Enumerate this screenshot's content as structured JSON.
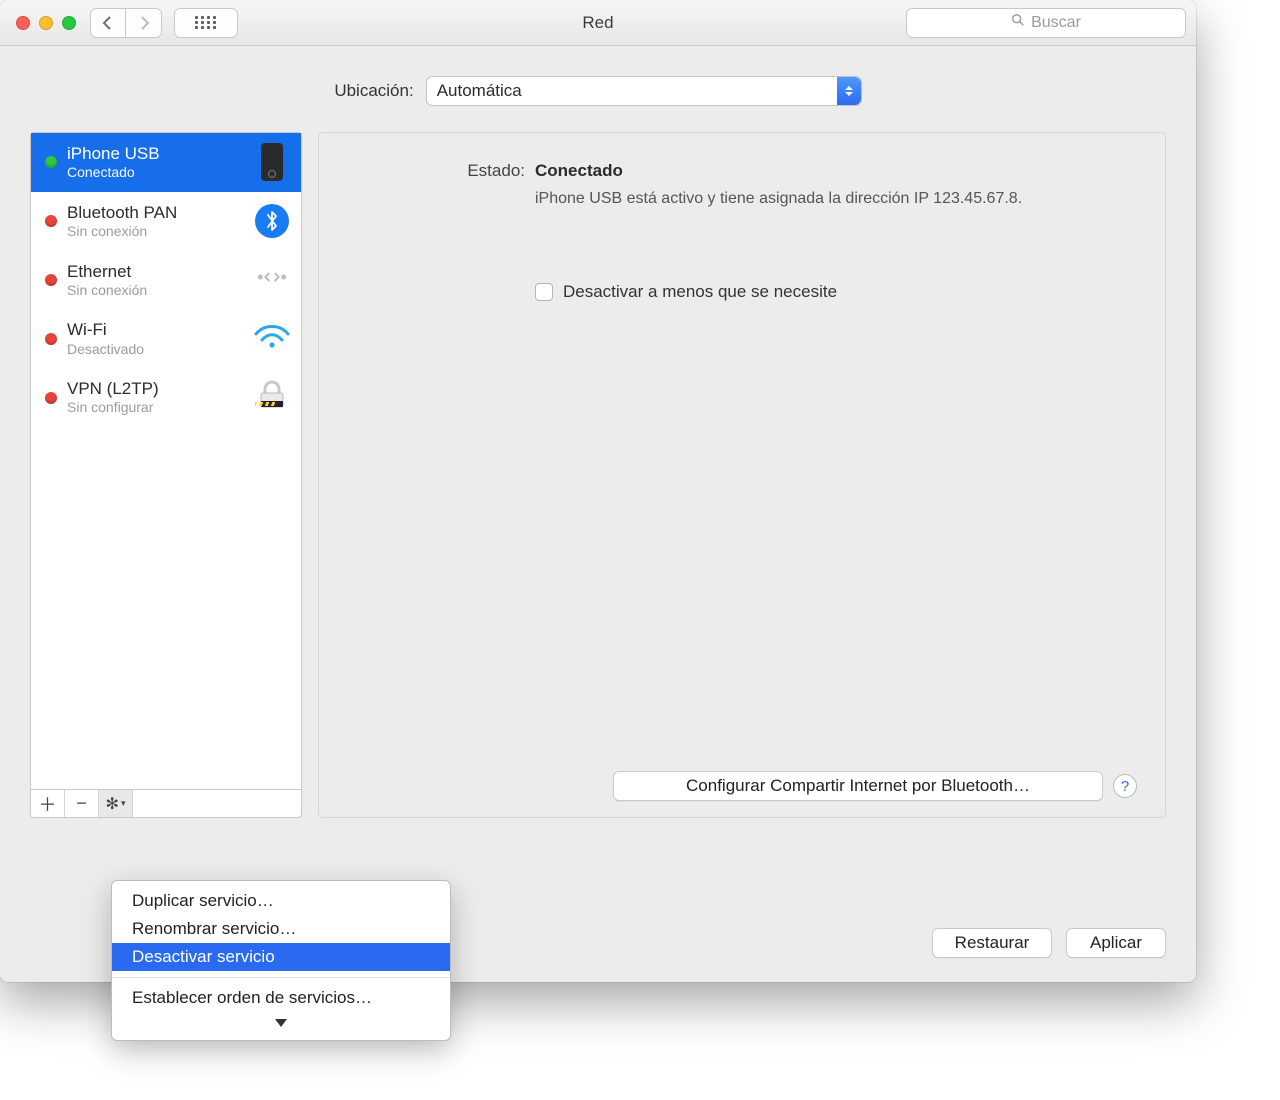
{
  "window": {
    "title": "Red"
  },
  "toolbar": {
    "search_placeholder": "Buscar"
  },
  "location": {
    "label": "Ubicación:",
    "value": "Automática"
  },
  "services": [
    {
      "name": "iPhone USB",
      "status": "Conectado",
      "dot": "green",
      "icon": "phone",
      "selected": true
    },
    {
      "name": "Bluetooth PAN",
      "status": "Sin conexión",
      "dot": "red",
      "icon": "bluetooth",
      "selected": false
    },
    {
      "name": "Ethernet",
      "status": "Sin conexión",
      "dot": "red",
      "icon": "ethernet",
      "selected": false
    },
    {
      "name": "Wi-Fi",
      "status": "Desactivado",
      "dot": "red",
      "icon": "wifi",
      "selected": false
    },
    {
      "name": "VPN (L2TP)",
      "status": "Sin configurar",
      "dot": "red",
      "icon": "lock",
      "selected": false
    }
  ],
  "detail": {
    "status_label": "Estado:",
    "status_value": "Conectado",
    "status_desc": "iPhone USB  está activo y tiene asignada la dirección IP 123.45.67.8.",
    "checkbox_label": "Desactivar a menos que se necesite",
    "config_button": "Configurar Compartir Internet por Bluetooth…",
    "help": "?"
  },
  "footer": {
    "restore": "Restaurar",
    "apply": "Aplicar"
  },
  "gear_menu": {
    "items": [
      {
        "label": "Duplicar servicio…",
        "sel": false
      },
      {
        "label": "Renombrar servicio…",
        "sel": false
      },
      {
        "label": "Desactivar servicio",
        "sel": true
      }
    ],
    "after_sep": "Establecer orden de servicios…"
  }
}
